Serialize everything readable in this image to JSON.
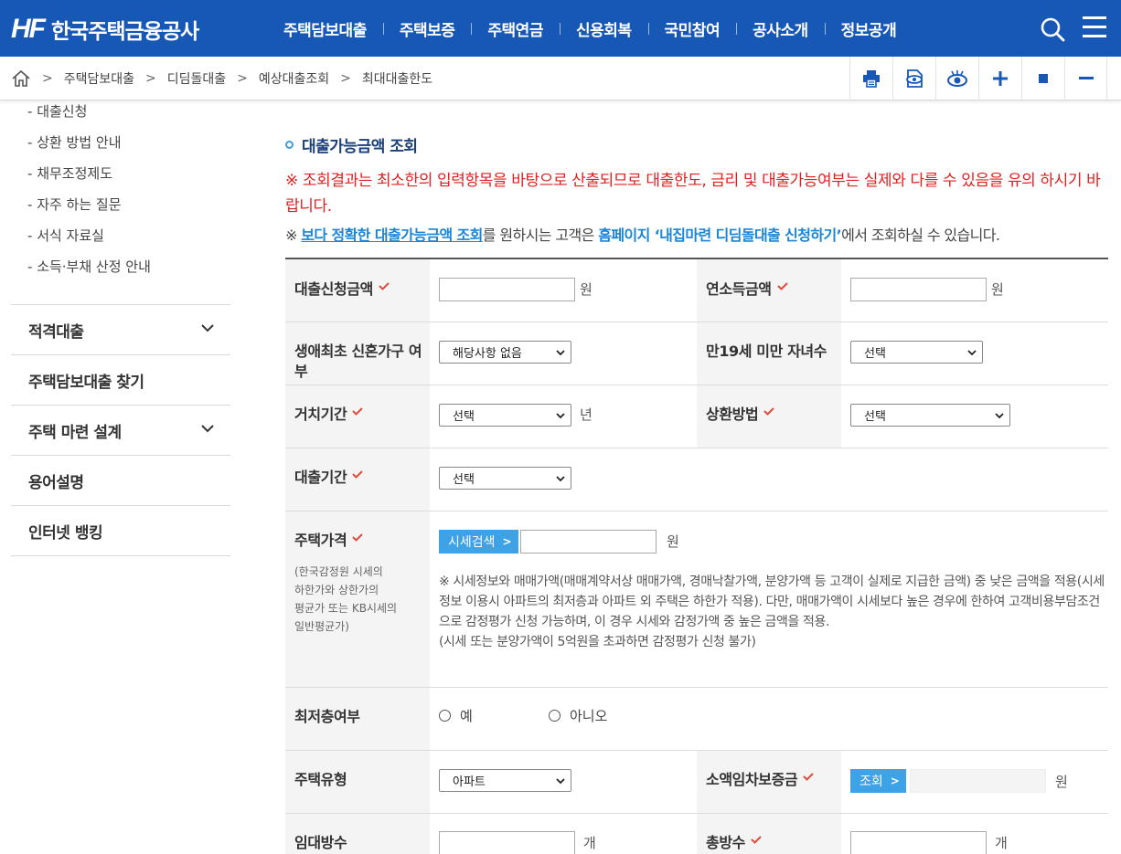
{
  "header": {
    "logo_mark": "HF",
    "logo_text": "한국주택금융공사",
    "nav": [
      "주택담보대출",
      "주택보증",
      "주택연금",
      "신용회복",
      "국민참여",
      "공사소개",
      "정보공개"
    ]
  },
  "breadcrumb": [
    "주택담보대출",
    "디딤돌대출",
    "예상대출조회",
    "최대대출한도"
  ],
  "sidebar": {
    "sub_items": [
      "대출신청",
      "상환 방법 안내",
      "채무조정제도",
      "자주 하는 질문",
      "서식 자료실",
      "소득·부채 산정 안내"
    ],
    "menus": [
      {
        "label": "적격대출",
        "expandable": true
      },
      {
        "label": "주택담보대출 찾기",
        "expandable": false
      },
      {
        "label": "주택 마련 설계",
        "expandable": true
      },
      {
        "label": "용어설명",
        "expandable": false
      },
      {
        "label": "인터넷 뱅킹",
        "expandable": false
      }
    ]
  },
  "content": {
    "section_title": "대출가능금액 조회",
    "warning": "※ 조회결과는 최소한의 입력항목을 바탕으로 산출되므로 대출한도, 금리 및 대출가능여부는 실제와 다를 수 있음을 유의 하시기 바랍니다.",
    "info_prefix": "※ ",
    "info_link1": "보다 정확한 대출가능금액 조회",
    "info_mid": "를 원하시는 고객은 ",
    "info_link2": "홈페이지 ‘내집마련 디딤돌대출 신청하기’",
    "info_suffix": "에서 조회하실 수 있습니다."
  },
  "form": {
    "loan_amount": {
      "label": "대출신청금액",
      "value": "",
      "unit": "원"
    },
    "annual_income": {
      "label": "연소득금액",
      "value": "",
      "unit": "원"
    },
    "first_newlywed": {
      "label": "생애최초 신혼가구 여부",
      "selected": "해당사항 없음"
    },
    "children": {
      "label": "만19세 미만 자녀수",
      "selected": "선택"
    },
    "grace_period": {
      "label": "거치기간",
      "selected": "선택",
      "unit": "년"
    },
    "repayment_method": {
      "label": "상환방법",
      "selected": "선택"
    },
    "loan_term": {
      "label": "대출기간",
      "selected": "선택"
    },
    "house_price": {
      "label": "주택가격",
      "sub_note": "(한국감정원 시세의\n하한가와 상한가의\n평균가 또는 KB시세의\n일반평균가)",
      "search_button": "시세검색",
      "value": "",
      "unit": "원",
      "note": "※ 시세정보와 매매가액(매매계약서상 매매가액, 경매낙찰가액, 분양가액 등 고객이 실제로 지급한 금액) 중 낮은 금액을 적용(시세정보 이용시 아파트의 최저층과 아파트 외 주택은 하한가 적용). 다만, 매매가액이 시세보다 높은 경우에 한하여 고객비용부담조건으로 감정평가 신청 가능하며, 이 경우 시세와 감정가액 중 높은 금액을 적용.\n(시세 또는 분양가액이 5억원을 초과하면 감정평가 신청 불가)"
    },
    "lowest_floor": {
      "label": "최저층여부",
      "options": [
        "예",
        "아니오"
      ]
    },
    "house_type": {
      "label": "주택유형",
      "selected": "아파트"
    },
    "small_deposit": {
      "label": "소액임차보증금",
      "button": "조회",
      "unit": "원"
    },
    "rental_rooms": {
      "label": "임대방수",
      "value": "",
      "unit": "개"
    },
    "total_rooms": {
      "label": "총방수",
      "value": "",
      "unit": "개"
    }
  },
  "colors": {
    "header_bg": "#1758b7",
    "warning": "#e1201f",
    "link": "#1a85d6",
    "button": "#3da2e6",
    "check": "#e14b3b"
  }
}
